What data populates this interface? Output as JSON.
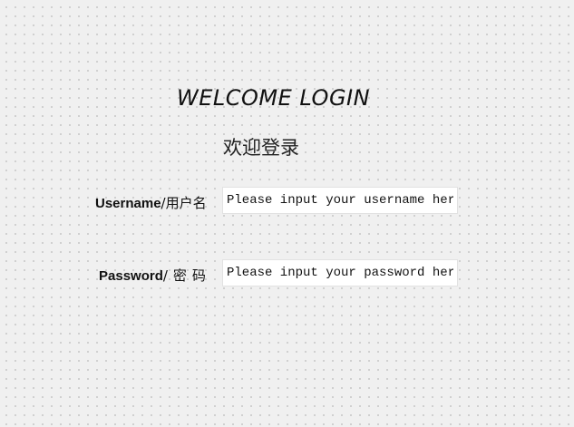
{
  "login": {
    "title_en": "WELCOME LOGIN",
    "title_cn": "欢迎登录",
    "username": {
      "label_en": "Username",
      "label_cn": "/用户名",
      "placeholder": "Please input your username here",
      "value": ""
    },
    "password": {
      "label_en": "Password",
      "label_cn": "/密码",
      "placeholder": "Please input your password here",
      "value": ""
    }
  },
  "colors": {
    "background": "#f0f0f0",
    "dot_grid": "#b4b4b4",
    "input_background": "#ffffff",
    "text": "#111111"
  }
}
